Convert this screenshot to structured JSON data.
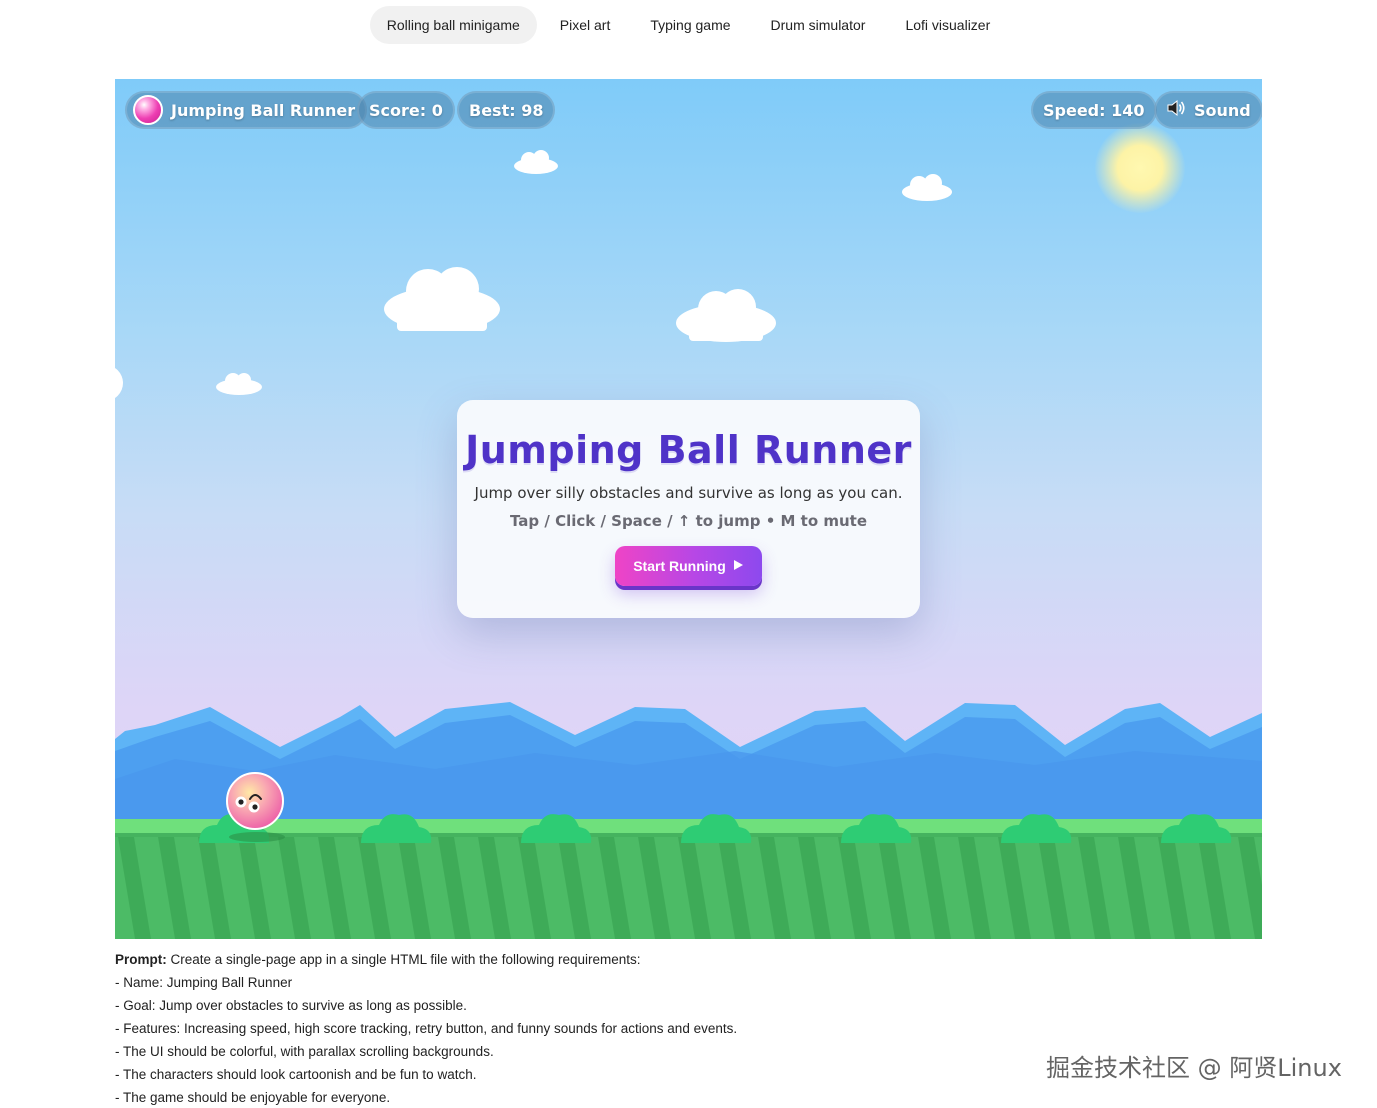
{
  "tabs": [
    {
      "label": "Rolling ball minigame",
      "active": true
    },
    {
      "label": "Pixel art",
      "active": false
    },
    {
      "label": "Typing game",
      "active": false
    },
    {
      "label": "Drum simulator",
      "active": false
    },
    {
      "label": "Lofi visualizer",
      "active": false
    }
  ],
  "hud": {
    "title": "Jumping Ball Runner",
    "score": "Score: 0",
    "best": "Best: 98",
    "speed": "Speed: 140",
    "sound": "Sound",
    "sound_icon": "speaker-icon"
  },
  "modal": {
    "title": "Jumping Ball Runner",
    "subtitle": "Jump over silly obstacles and survive as long as you can.",
    "controls": "Tap / Click / Space / ↑ to jump • M to mute",
    "start_label": "Start Running",
    "start_icon": "play-icon"
  },
  "prompt": {
    "label": "Prompt:",
    "intro": "Create a single-page app in a single HTML file with the following requirements:",
    "lines": [
      "- Name: Jumping Ball Runner",
      "- Goal: Jump over obstacles to survive as long as possible.",
      "- Features: Increasing speed, high score tracking, retry button, and funny sounds for actions and events.",
      "- The UI should be colorful, with parallax scrolling backgrounds.",
      "- The characters should look cartoonish and be fun to watch.",
      "- The game should be enjoyable for everyone."
    ]
  },
  "watermark": "掘金技术社区 @ 阿贤Linux",
  "colors": {
    "sky_top": "#7fcbf9",
    "sky_bottom": "#e3d4f6",
    "hills": "#5aaaf5",
    "grass": "#4fc66a",
    "title_purple": "#4f33c8",
    "button_pink": "#ef44c6",
    "button_purple": "#8d49ee"
  }
}
